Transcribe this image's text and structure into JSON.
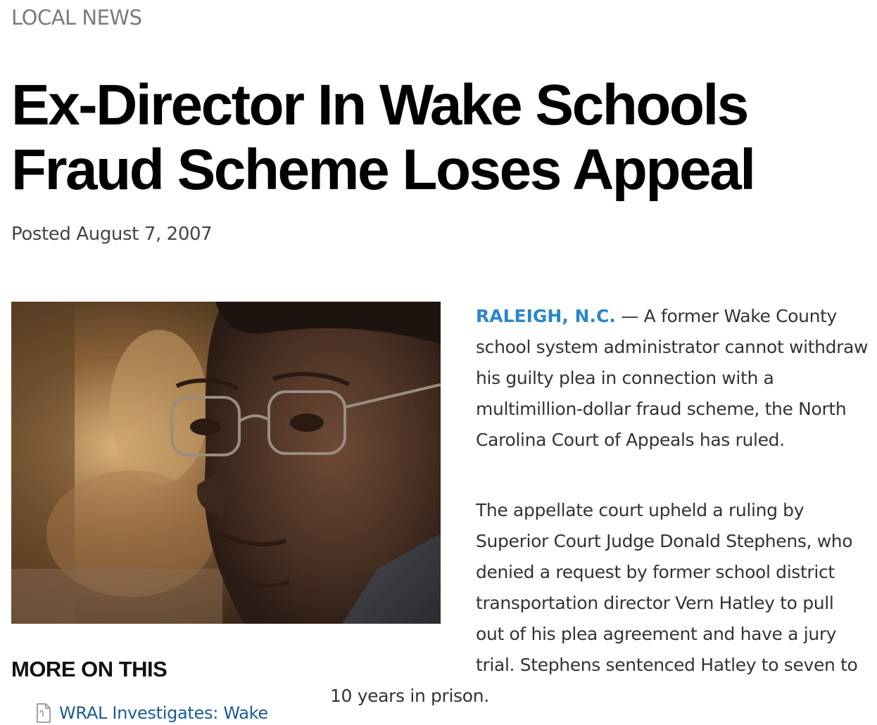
{
  "section": "LOCAL NEWS",
  "headline": {
    "line1": "Ex-Director In Wake Schools",
    "line2": "Fraud Scheme Loses Appeal"
  },
  "posted": "Posted August 7, 2007",
  "photo": {
    "icon": "man-with-glasses-photo"
  },
  "story": {
    "dateline": "RALEIGH, N.C.",
    "para1_text": " — A former Wake County school system administrator cannot withdraw his guilty plea in connection with a multimillion-dollar fraud scheme, the North Carolina Court of Appeals has ruled.",
    "para2_lines": [
      "The appellate court upheld a ruling by",
      "Superior Court Judge Donald Stephens, who",
      "denied a request by former school district",
      "transportation director Vern Hatley to pull",
      "out of his plea agreement and have a jury",
      "trial. Stephens sentenced Hatley to seven to"
    ],
    "para2_tail": "10 years in prison."
  },
  "more": {
    "title": "MORE ON THIS",
    "items": [
      {
        "label": "WRAL Investigates: Wake",
        "icon": "document-icon"
      }
    ]
  },
  "colors": {
    "dateline": "#2b87c8",
    "link": "#1a5a96",
    "section": "#7b7b7b"
  }
}
